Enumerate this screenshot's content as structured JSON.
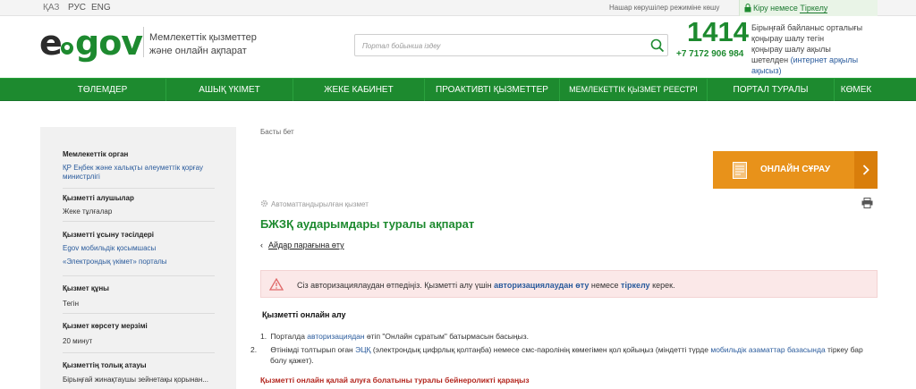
{
  "topbar": {
    "languages": [
      "ҚАЗ",
      "РУС",
      "ENG"
    ],
    "accessibility": "Нашар көрушілер режиміне көшу",
    "login_prefix": "Кіру немесе ",
    "login_link": "Тіркелу"
  },
  "header": {
    "logo_e": "e",
    "logo_gov": "gov",
    "slogan_line1": "Мемлекеттік қызметтер",
    "slogan_line2": "және онлайн ақпарат",
    "search_placeholder": "Портал бойынша іздеу",
    "call_number": "1414",
    "phone": "+7 7172 906 984",
    "call_info_1": "Бірыңғай байланыс орталығы",
    "call_info_2": "қоңырау шалу тегін",
    "call_info_3": "қоңырау шалу ақылы",
    "call_info_4": "шетелден ",
    "call_info_link": "(интернет арқылы ақысыз)"
  },
  "nav": {
    "items": [
      "Төлемдер",
      "Ашық үкімет",
      "Жеке кабинет",
      "Проактивті қызметтер",
      "Мемлекеттік қызмет реестрі",
      "Портал туралы",
      "Көмек"
    ]
  },
  "sidebar": {
    "org_title": "Мемлекеттік орган",
    "org_link": "ҚР Еңбек және халықты әлеуметтік қорғау министрлігі",
    "recipients_title": "Қызметті алушылар",
    "recipients_value": "Жеке тұлғалар",
    "channels_title": "Қызметті ұсыну тәсілдері",
    "channel_1": "Egov мобильдік қосымшасы",
    "channel_2": "«Электрондық үкімет» порталы",
    "price_title": "Қызмет құны",
    "price_value": "Тегін",
    "term_title": "Қызмет көрсету мерзімі",
    "term_value": "20 минут",
    "fullname_title": "Қызметтің толық атауы",
    "fullname_value": "Бірыңғай жинақтаушы зейнетақы қорынан..."
  },
  "main": {
    "breadcrumb": "Басты бет",
    "online_button": "ОНЛАЙН СҰРАУ",
    "auto_label": "Автоматтандырылған қызмет",
    "title": "БЖЗҚ аударымдары туралы ақпарат",
    "back_link": "Айдар парағына өту",
    "alert_text_1": "Сіз авторизациялаудан өтпедіңіз. Қызметті алу үшін ",
    "alert_link_1": "авторизациялаудан өту",
    "alert_text_2": " немесе ",
    "alert_link_2": "тіркелу",
    "alert_text_3": " керек.",
    "section_title": "Қызметті онлайн алу",
    "step1_num": "1.",
    "step1_a": "Порталда ",
    "step1_link": "авторизациядан",
    "step1_b": " өтіп \"Онлайн сұратым\" батырмасын басыңыз.",
    "step2_num": "2.",
    "step2_a": "Өтінімді толтырып оған ",
    "step2_link1": "ЭЦҚ",
    "step2_b": " (электрондық цифрлық қолтаңба) немесе смс-паролінің көмегімен қол қойыңыз (міндетті түрде ",
    "step2_link2": "мобильдік азаматтар базасында",
    "step2_c": " тіркеу бар болу қажет).",
    "video_link": "Қызметті онлайн қалай алуға болатыны туралы бейнероликті қараңыз"
  },
  "colors": {
    "brand_green": "#1d8a2f",
    "accent_orange": "#e8921a",
    "alert_bg": "#fbe8e8",
    "link_blue": "#2a5b9c"
  }
}
